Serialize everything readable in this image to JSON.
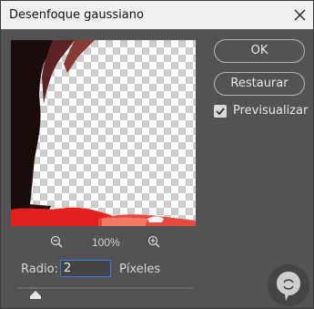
{
  "window": {
    "title": "Desenfoque gaussiano"
  },
  "buttons": {
    "ok_label": "OK",
    "reset_label": "Restaurar"
  },
  "preview_option": {
    "label": "Previsualizar",
    "checked": true
  },
  "zoom": {
    "level": "100%"
  },
  "radius": {
    "label": "Radio:",
    "value": "2",
    "unit": "Píxeles",
    "slider_level": 0.08
  },
  "colors": {
    "accent_focus": "#3d7be0",
    "panel_bg": "#535353",
    "titlebar_bg": "#f0f0f0"
  },
  "icons": {
    "close": "close-icon",
    "zoom_out": "zoom-out-icon",
    "zoom_in": "zoom-in-icon",
    "check": "checkmark-icon"
  }
}
